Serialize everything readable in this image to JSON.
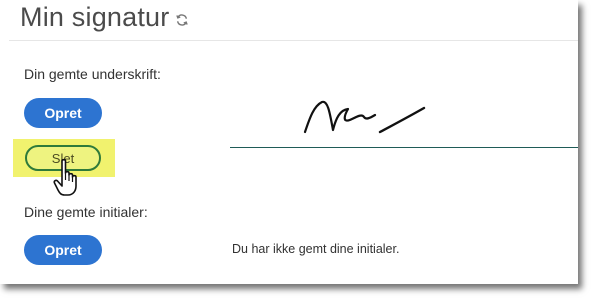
{
  "header": {
    "title": "Min signatur",
    "refresh_icon": "refresh-icon"
  },
  "signature_section": {
    "label": "Din gemte underskrift:",
    "create_label": "Opret",
    "delete_label": "Slet",
    "signature_image": "handwritten-signature"
  },
  "initials_section": {
    "label": "Dine gemte initialer:",
    "create_label": "Opret",
    "empty_text": "Du har ikke gemt dine initialer."
  },
  "colors": {
    "primary_button": "#2d74d1",
    "highlight": "#f1f26e",
    "signature_line": "#1f5b57"
  }
}
